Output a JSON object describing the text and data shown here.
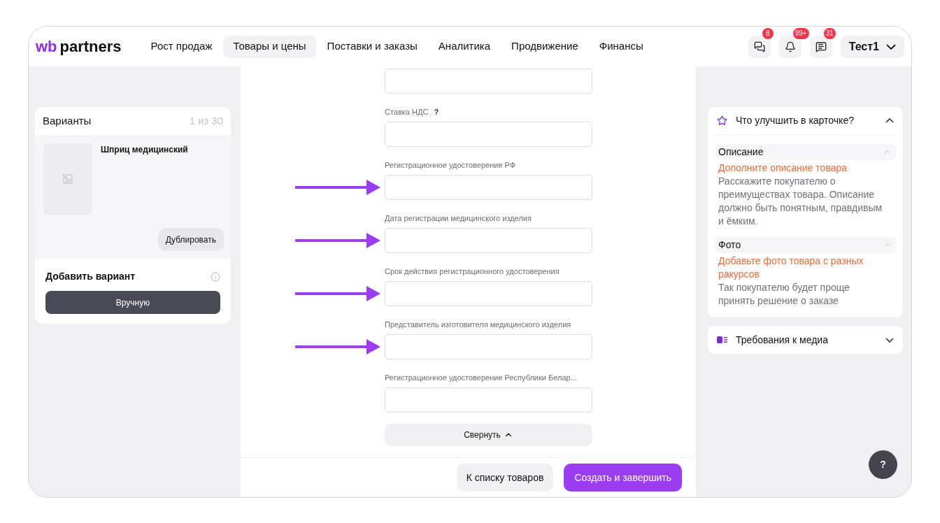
{
  "header": {
    "logo_prefix": "wb",
    "logo_suffix": "partners",
    "nav": [
      {
        "label": "Рост продаж",
        "selected": false
      },
      {
        "label": "Товары и цены",
        "selected": true
      },
      {
        "label": "Поставки и заказы",
        "selected": false
      },
      {
        "label": "Аналитика",
        "selected": false
      },
      {
        "label": "Продвижение",
        "selected": false
      },
      {
        "label": "Финансы",
        "selected": false
      }
    ],
    "icons": [
      {
        "kind": "chat",
        "badge": "8"
      },
      {
        "kind": "bell",
        "badge": "99+"
      },
      {
        "kind": "help",
        "badge": "31"
      }
    ],
    "user": "Тест1"
  },
  "variants": {
    "title": "Варианты",
    "count": "1 из 30",
    "item": {
      "name": "Шприц медицинский",
      "button": "Дублировать"
    },
    "add_title": "Добавить вариант",
    "add_button": "Вручную"
  },
  "form": {
    "fields": [
      {
        "help": false,
        "arrow": false
      },
      {
        "label": "Ставка НДС",
        "help": true,
        "arrow": false
      },
      {
        "label": "Регистрационное удостоверение РФ",
        "help": false,
        "arrow": true
      },
      {
        "label": "Дата регистрации медицинского изделия",
        "help": false,
        "arrow": true
      },
      {
        "label": "Срок действия регистрационного удостоверения",
        "help": false,
        "arrow": true
      },
      {
        "label": "Представитель изготовителя медицинского изделия",
        "help": false,
        "arrow": true
      },
      {
        "label": "Регистрационное удостоверение Республики Белар...",
        "help": false,
        "arrow": false
      }
    ],
    "help_mark": "?",
    "collapse": "Свернуть",
    "back": "К списку товаров",
    "submit": "Создать и завершить"
  },
  "tips": {
    "title": "Что улучшить в карточке?",
    "expanded": true,
    "sections": [
      {
        "title": "Описание",
        "link": "Дополните описание товара",
        "text": "Расскажите покупателю о преимуществах товара. Описание должно быть понятным, правдивым и ёмким."
      },
      {
        "title": "Фото",
        "link": "Добавьте фото товара с разных ракурсов",
        "text": "Так покупателю будет проще принять решение о заказе"
      }
    ]
  },
  "media": {
    "title": "Требования к медиа",
    "expanded": false
  },
  "help_button": "?"
}
